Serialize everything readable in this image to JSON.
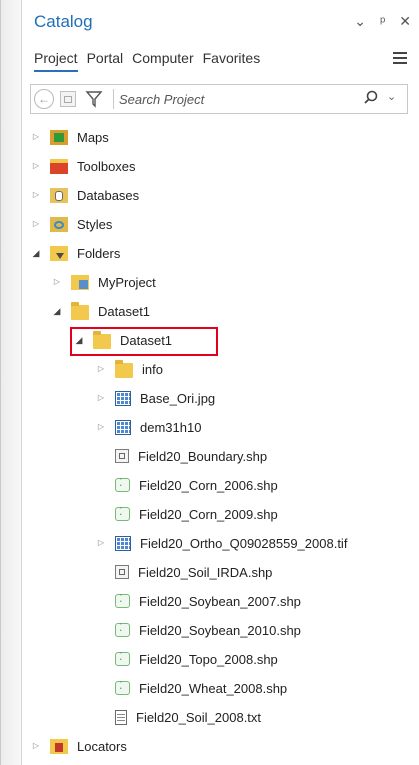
{
  "catalog": {
    "title": "Catalog"
  },
  "header_icons": [
    "chevron-down-icon",
    "pin-icon",
    "close-icon"
  ],
  "tabs": [
    {
      "label": "Project",
      "active": true
    },
    {
      "label": "Portal",
      "active": false
    },
    {
      "label": "Computer",
      "active": false
    },
    {
      "label": "Favorites",
      "active": false
    }
  ],
  "search": {
    "placeholder": "Search Project"
  },
  "tree": [
    {
      "label": "Maps",
      "icon": "maps-icon",
      "expander": "collapsed"
    },
    {
      "label": "Toolboxes",
      "icon": "toolbox-icon",
      "expander": "collapsed"
    },
    {
      "label": "Databases",
      "icon": "database-icon",
      "expander": "collapsed"
    },
    {
      "label": "Styles",
      "icon": "styles-icon",
      "expander": "collapsed"
    },
    {
      "label": "Folders",
      "icon": "folders-icon",
      "expander": "expanded"
    },
    {
      "label": "MyProject",
      "icon": "project-folder-icon",
      "expander": "collapsed"
    },
    {
      "label": "Dataset1",
      "icon": "folder-icon",
      "expander": "expanded"
    },
    {
      "label": "Dataset1",
      "icon": "folder-icon",
      "expander": "expanded"
    },
    {
      "label": "info",
      "icon": "folder-icon",
      "expander": "collapsed"
    },
    {
      "label": "Base_Ori.jpg",
      "icon": "raster-icon",
      "expander": "collapsed"
    },
    {
      "label": "dem31h10",
      "icon": "raster-icon",
      "expander": "collapsed"
    },
    {
      "label": "Field20_Boundary.shp",
      "icon": "polygon-shapefile-icon",
      "expander": "none"
    },
    {
      "label": "Field20_Corn_2006.shp",
      "icon": "point-shapefile-icon",
      "expander": "none"
    },
    {
      "label": "Field20_Corn_2009.shp",
      "icon": "point-shapefile-icon",
      "expander": "none"
    },
    {
      "label": "Field20_Ortho_Q09028559_2008.tif",
      "icon": "raster-icon",
      "expander": "collapsed"
    },
    {
      "label": "Field20_Soil_IRDA.shp",
      "icon": "polygon-shapefile-icon",
      "expander": "none"
    },
    {
      "label": "Field20_Soybean_2007.shp",
      "icon": "point-shapefile-icon",
      "expander": "none"
    },
    {
      "label": "Field20_Soybean_2010.shp",
      "icon": "point-shapefile-icon",
      "expander": "none"
    },
    {
      "label": "Field20_Topo_2008.shp",
      "icon": "point-shapefile-icon",
      "expander": "none"
    },
    {
      "label": "Field20_Wheat_2008.shp",
      "icon": "point-shapefile-icon",
      "expander": "none"
    },
    {
      "label": "Field20_Soil_2008.txt",
      "icon": "text-file-icon",
      "expander": "none"
    },
    {
      "label": "Locators",
      "icon": "locator-icon",
      "expander": "collapsed"
    }
  ],
  "colors": {
    "title": "#1f6fb8",
    "highlight": "#e2001a",
    "folder": "#f2c94c"
  }
}
